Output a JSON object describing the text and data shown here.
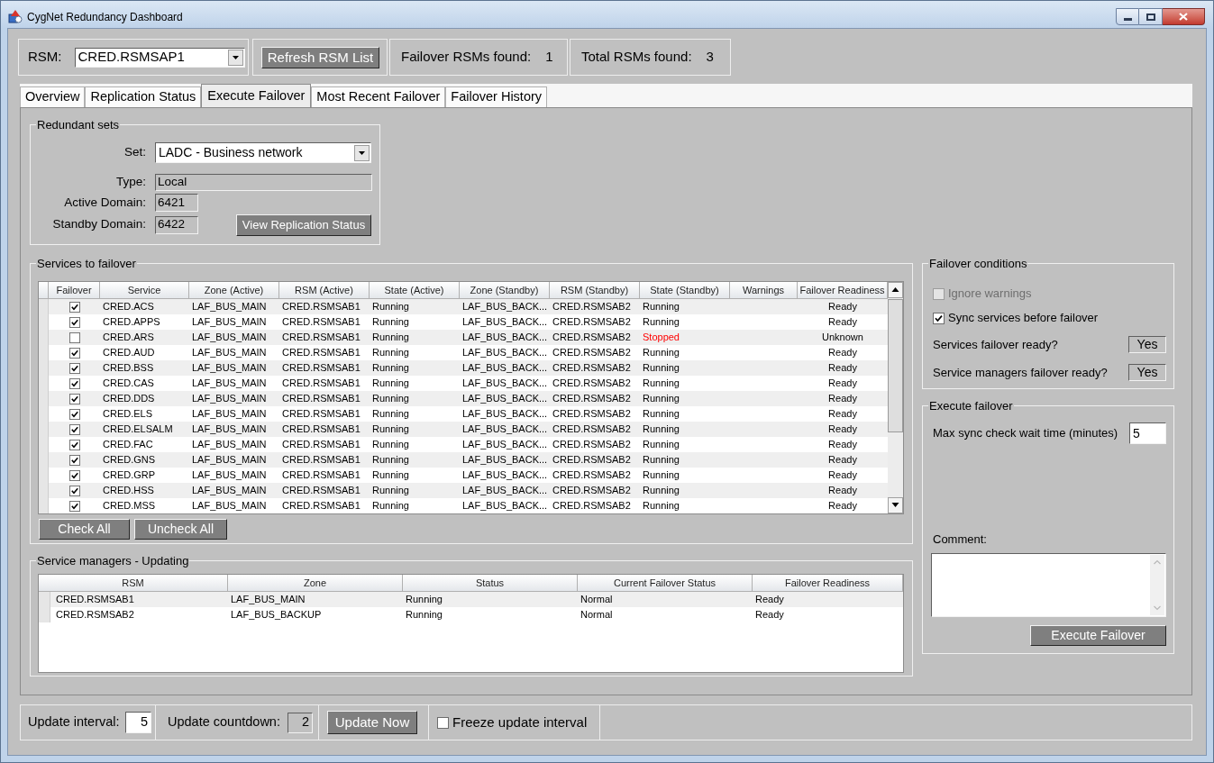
{
  "window": {
    "title": "CygNet Redundancy Dashboard"
  },
  "toolbar": {
    "rsm": {
      "label": "RSM:",
      "value": "CRED.RSMSAP1"
    },
    "refresh_button": "Refresh RSM List",
    "counters": [
      {
        "label": "Failover RSMs found:",
        "value": "1"
      },
      {
        "label": "Total RSMs found:",
        "value": "3"
      }
    ]
  },
  "tabs": [
    {
      "label": "Overview",
      "selected": false
    },
    {
      "label": "Replication Status",
      "selected": false
    },
    {
      "label": "Execute Failover",
      "selected": true
    },
    {
      "label": "Most Recent Failover",
      "selected": false
    },
    {
      "label": "Failover History",
      "selected": false
    }
  ],
  "redundant_sets": {
    "title": "Redundant sets",
    "set": {
      "label": "Set:",
      "value": "LADC - Business network"
    },
    "type": {
      "label": "Type:",
      "value": "Local"
    },
    "active_domain": {
      "label": "Active Domain:",
      "value": "6421"
    },
    "standby_domain": {
      "label": "Standby Domain:",
      "value": "6422"
    },
    "view_button": "View Replication Status"
  },
  "services": {
    "title": "Services to failover",
    "columns": [
      "Failover",
      "Service",
      "Zone (Active)",
      "RSM (Active)",
      "State (Active)",
      "Zone (Standby)",
      "RSM (Standby)",
      "State (Standby)",
      "Warnings",
      "Failover Readiness"
    ],
    "rows": [
      {
        "checked": true,
        "service": "CRED.ACS",
        "zone_active": "LAF_BUS_MAIN",
        "rsm_active": "CRED.RSMSAB1",
        "state_active": "Running",
        "zone_standby": "LAF_BUS_BACK...",
        "rsm_standby": "CRED.RSMSAB2",
        "state_standby": "Running",
        "alert": false,
        "readiness": "Ready"
      },
      {
        "checked": true,
        "service": "CRED.APPS",
        "zone_active": "LAF_BUS_MAIN",
        "rsm_active": "CRED.RSMSAB1",
        "state_active": "Running",
        "zone_standby": "LAF_BUS_BACK...",
        "rsm_standby": "CRED.RSMSAB2",
        "state_standby": "Running",
        "alert": false,
        "readiness": "Ready"
      },
      {
        "checked": false,
        "service": "CRED.ARS",
        "zone_active": "LAF_BUS_MAIN",
        "rsm_active": "CRED.RSMSAB1",
        "state_active": "Running",
        "zone_standby": "LAF_BUS_BACK...",
        "rsm_standby": "CRED.RSMSAB2",
        "state_standby": "Stopped",
        "alert": true,
        "readiness": "Unknown"
      },
      {
        "checked": true,
        "service": "CRED.AUD",
        "zone_active": "LAF_BUS_MAIN",
        "rsm_active": "CRED.RSMSAB1",
        "state_active": "Running",
        "zone_standby": "LAF_BUS_BACK...",
        "rsm_standby": "CRED.RSMSAB2",
        "state_standby": "Running",
        "alert": false,
        "readiness": "Ready"
      },
      {
        "checked": true,
        "service": "CRED.BSS",
        "zone_active": "LAF_BUS_MAIN",
        "rsm_active": "CRED.RSMSAB1",
        "state_active": "Running",
        "zone_standby": "LAF_BUS_BACK...",
        "rsm_standby": "CRED.RSMSAB2",
        "state_standby": "Running",
        "alert": false,
        "readiness": "Ready"
      },
      {
        "checked": true,
        "service": "CRED.CAS",
        "zone_active": "LAF_BUS_MAIN",
        "rsm_active": "CRED.RSMSAB1",
        "state_active": "Running",
        "zone_standby": "LAF_BUS_BACK...",
        "rsm_standby": "CRED.RSMSAB2",
        "state_standby": "Running",
        "alert": false,
        "readiness": "Ready"
      },
      {
        "checked": true,
        "service": "CRED.DDS",
        "zone_active": "LAF_BUS_MAIN",
        "rsm_active": "CRED.RSMSAB1",
        "state_active": "Running",
        "zone_standby": "LAF_BUS_BACK...",
        "rsm_standby": "CRED.RSMSAB2",
        "state_standby": "Running",
        "alert": false,
        "readiness": "Ready"
      },
      {
        "checked": true,
        "service": "CRED.ELS",
        "zone_active": "LAF_BUS_MAIN",
        "rsm_active": "CRED.RSMSAB1",
        "state_active": "Running",
        "zone_standby": "LAF_BUS_BACK...",
        "rsm_standby": "CRED.RSMSAB2",
        "state_standby": "Running",
        "alert": false,
        "readiness": "Ready"
      },
      {
        "checked": true,
        "service": "CRED.ELSALM",
        "zone_active": "LAF_BUS_MAIN",
        "rsm_active": "CRED.RSMSAB1",
        "state_active": "Running",
        "zone_standby": "LAF_BUS_BACK...",
        "rsm_standby": "CRED.RSMSAB2",
        "state_standby": "Running",
        "alert": false,
        "readiness": "Ready"
      },
      {
        "checked": true,
        "service": "CRED.FAC",
        "zone_active": "LAF_BUS_MAIN",
        "rsm_active": "CRED.RSMSAB1",
        "state_active": "Running",
        "zone_standby": "LAF_BUS_BACK...",
        "rsm_standby": "CRED.RSMSAB2",
        "state_standby": "Running",
        "alert": false,
        "readiness": "Ready"
      },
      {
        "checked": true,
        "service": "CRED.GNS",
        "zone_active": "LAF_BUS_MAIN",
        "rsm_active": "CRED.RSMSAB1",
        "state_active": "Running",
        "zone_standby": "LAF_BUS_BACK...",
        "rsm_standby": "CRED.RSMSAB2",
        "state_standby": "Running",
        "alert": false,
        "readiness": "Ready"
      },
      {
        "checked": true,
        "service": "CRED.GRP",
        "zone_active": "LAF_BUS_MAIN",
        "rsm_active": "CRED.RSMSAB1",
        "state_active": "Running",
        "zone_standby": "LAF_BUS_BACK...",
        "rsm_standby": "CRED.RSMSAB2",
        "state_standby": "Running",
        "alert": false,
        "readiness": "Ready"
      },
      {
        "checked": true,
        "service": "CRED.HSS",
        "zone_active": "LAF_BUS_MAIN",
        "rsm_active": "CRED.RSMSAB1",
        "state_active": "Running",
        "zone_standby": "LAF_BUS_BACK...",
        "rsm_standby": "CRED.RSMSAB2",
        "state_standby": "Running",
        "alert": false,
        "readiness": "Ready"
      },
      {
        "checked": true,
        "service": "CRED.MSS",
        "zone_active": "LAF_BUS_MAIN",
        "rsm_active": "CRED.RSMSAB1",
        "state_active": "Running",
        "zone_standby": "LAF_BUS_BACK...",
        "rsm_standby": "CRED.RSMSAB2",
        "state_standby": "Running",
        "alert": false,
        "readiness": "Ready"
      }
    ],
    "buttons": [
      "Check All",
      "Uncheck All"
    ]
  },
  "service_managers": {
    "title": "Service managers - Updating",
    "columns": [
      "RSM",
      "Zone",
      "Status",
      "Current Failover Status",
      "Failover Readiness"
    ],
    "rows": [
      {
        "rsm": "CRED.RSMSAB1",
        "zone": "LAF_BUS_MAIN",
        "status": "Running",
        "failover_status": "Normal",
        "readiness": "Ready"
      },
      {
        "rsm": "CRED.RSMSAB2",
        "zone": "LAF_BUS_BACKUP",
        "status": "Running",
        "failover_status": "Normal",
        "readiness": "Ready"
      }
    ]
  },
  "failover_conditions": {
    "title": "Failover conditions",
    "options": [
      {
        "label": "Ignore warnings",
        "checked": false,
        "disabled": true
      },
      {
        "label": "Sync services before failover",
        "checked": true,
        "disabled": false
      }
    ],
    "readiness": [
      {
        "label": "Services failover ready?",
        "value": "Yes"
      },
      {
        "label": "Service managers failover ready?",
        "value": "Yes"
      }
    ]
  },
  "execute_failover": {
    "title": "Execute failover",
    "max_wait": {
      "label": "Max sync check wait time (minutes)",
      "value": "5"
    },
    "comment": {
      "label": "Comment:"
    },
    "button": "Execute Failover"
  },
  "status_bar": {
    "update_interval": {
      "label": "Update interval:",
      "value": "5"
    },
    "countdown": {
      "label": "Update countdown:",
      "value": "2"
    },
    "update_button": "Update Now",
    "freeze": {
      "label": "Freeze update interval",
      "checked": false
    }
  }
}
